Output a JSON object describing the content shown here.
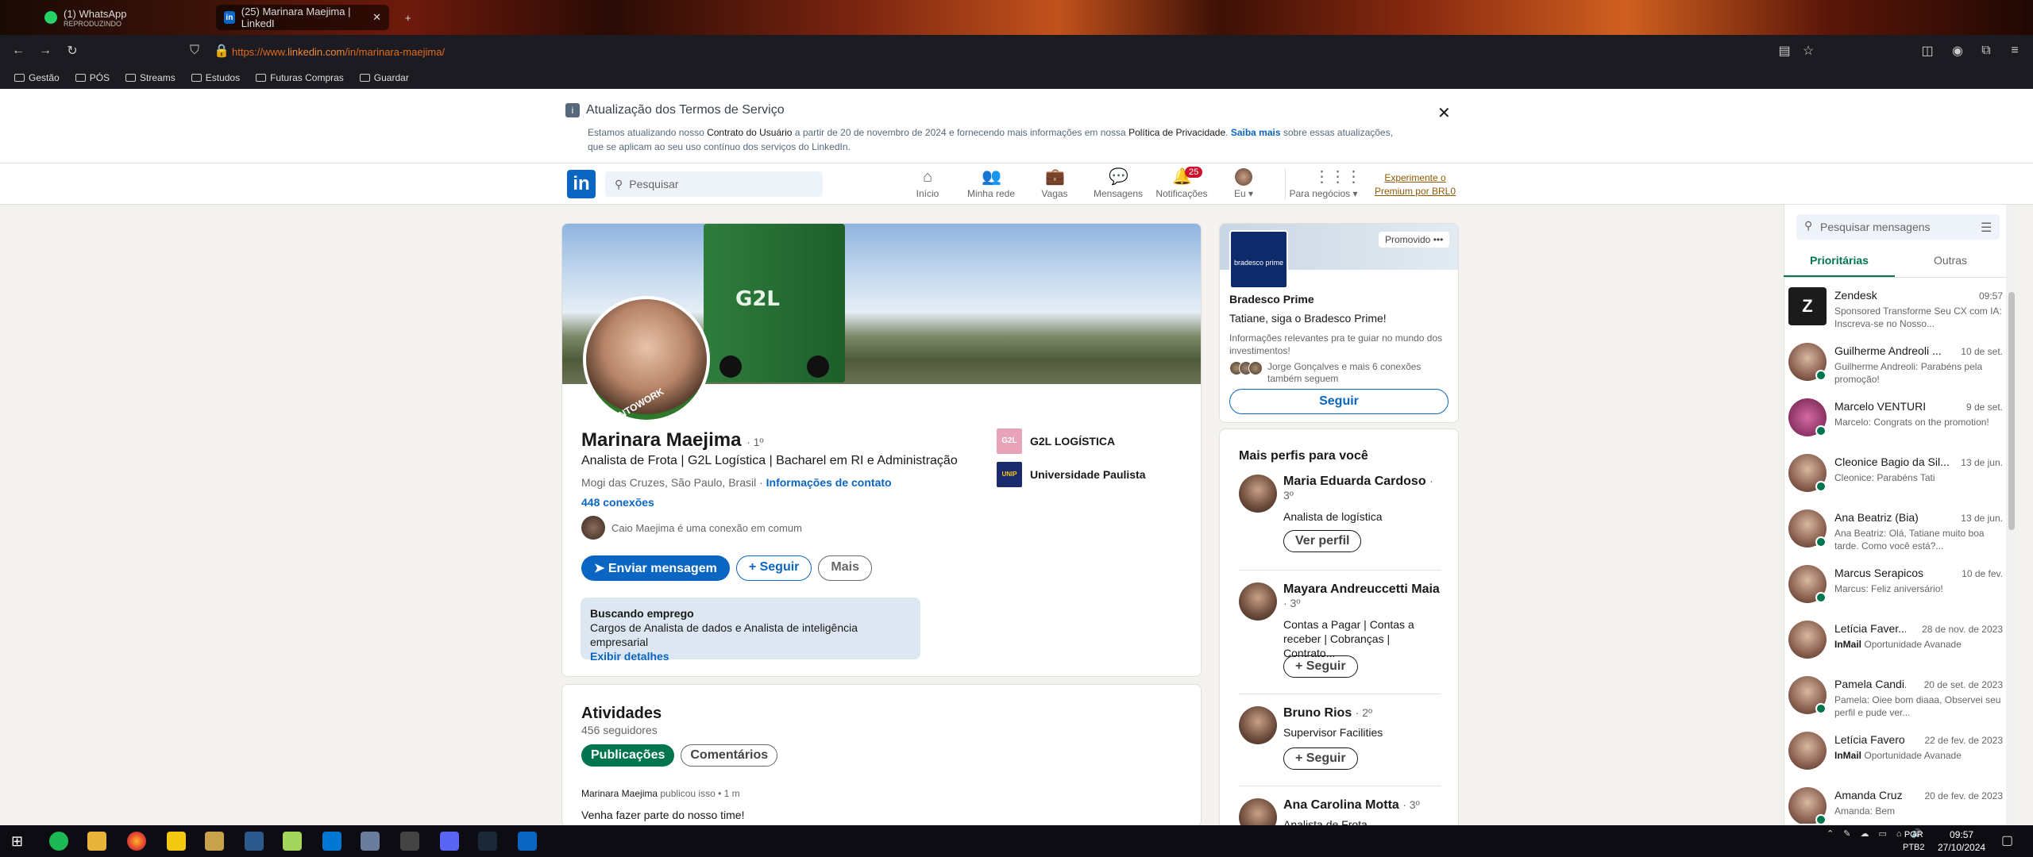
{
  "browser": {
    "tabs": [
      {
        "title": "(1) WhatsApp",
        "subtitle": "REPRODUZINDO"
      },
      {
        "title": "(25) Marinara Maejima | LinkedI"
      }
    ],
    "url_prefix": "https://www.",
    "url_host": "linkedin.com",
    "url_path": "/in/marinara-maejima/",
    "bookmarks": [
      "Gestão",
      "PÓS",
      "Streams",
      "Estudos",
      "Futuras Compras",
      "Guardar"
    ]
  },
  "banner": {
    "title": "Atualização dos Termos de Serviço",
    "text_1": "Estamos atualizando nosso ",
    "link_1": "Contrato do Usuário",
    "text_2": " a partir de 20 de novembro de 2024 e fornecendo mais informações em nossa ",
    "link_2": "Política de Privacidade",
    "text_3": ". ",
    "link_3": "Saiba mais",
    "text_4": " sobre essas atualizações, que se aplicam ao seu uso contínuo dos serviços do LinkedIn."
  },
  "header": {
    "logo": "in",
    "search_placeholder": "Pesquisar",
    "nav": [
      {
        "label": "Início",
        "icon": "home-icon"
      },
      {
        "label": "Minha rede",
        "icon": "network-icon"
      },
      {
        "label": "Vagas",
        "icon": "briefcase-icon"
      },
      {
        "label": "Mensagens",
        "icon": "chat-icon"
      },
      {
        "label": "Notificações",
        "icon": "bell-icon",
        "badge": "25"
      },
      {
        "label": "Eu",
        "icon": "avatar-icon"
      },
      {
        "label": "Para negócios",
        "icon": "grid-icon"
      }
    ],
    "premium": "Experimente o Premium por BRL0"
  },
  "profile": {
    "name": "Marinara Maejima",
    "degree": "· 1º",
    "headline": "Analista de Frota | G2L Logística | Bacharel em RI e Administração",
    "location": "Mogi das Cruzes, São Paulo, Brasil ·",
    "contact_link": "Informações de contato",
    "connections": "448 conexões",
    "mutual_name": "Caio Maejima",
    "mutual_text": "é uma conexão em comum",
    "cover_text": "G2L",
    "avatar_ring": "#OPENTOWORK",
    "actions": {
      "message": "Enviar mensagem",
      "follow": "+ Seguir",
      "more": "Mais"
    },
    "orgs": [
      {
        "name": "G2L LOGÍSTICA",
        "logo_text": "G2L",
        "color": "#e8a3b8"
      },
      {
        "name": "Universidade Paulista",
        "logo_text": "UNIP",
        "color": "#1a2a6c"
      }
    ],
    "open_to_work": {
      "title": "Buscando emprego",
      "roles": "Cargos de Analista de dados e Analista de inteligência empresarial",
      "link": "Exibir detalhes"
    }
  },
  "activity": {
    "title": "Atividades",
    "followers": "456 seguidores",
    "tabs": [
      "Publicações",
      "Comentários"
    ],
    "meta_name": "Marinara Maejima",
    "meta_rest": "publicou isso • 1 m",
    "post": "Venha fazer parte do nosso time!"
  },
  "ad": {
    "promo_label": "Promovido",
    "logo_text": "bradesco prime",
    "brand": "Bradesco Prime",
    "tagline": "Tatiane, siga o Bradesco Prime!",
    "description": "Informações relevantes pra te guiar no mundo dos investimentos!",
    "social": "Jorge Gonçalves e mais 6 conexões também seguem",
    "follow": "Seguir"
  },
  "more_profiles": {
    "title": "Mais perfis para você",
    "people": [
      {
        "name": "Maria Eduarda Cardoso",
        "degree": "· 3º",
        "desc": "Analista de logística",
        "button": "Ver perfil"
      },
      {
        "name": "Mayara Andreuccetti Maia",
        "degree": "· 3º",
        "desc": "Contas a Pagar | Contas a receber | Cobranças | Contrato...",
        "button": "+ Seguir"
      },
      {
        "name": "Bruno Rios",
        "degree": "· 2º",
        "desc": "Supervisor Facilities",
        "button": "+ Seguir"
      },
      {
        "name": "Ana Carolina Motta",
        "degree": "· 3º",
        "desc": "Analista de Frota",
        "button": ""
      }
    ]
  },
  "messaging": {
    "search_placeholder": "Pesquisar mensagens",
    "tabs": [
      "Prioritárias",
      "Outras"
    ],
    "conversations": [
      {
        "name": "Zendesk",
        "date": "09:57",
        "prefix": "Sponsored",
        "preview": "Transforme Seu CX com IA: Inscreva-se no Nosso..."
      },
      {
        "name": "Guilherme Andreoli ...",
        "date": "10 de set.",
        "prefix": "",
        "preview": "Guilherme Andreoli: Parabéns pela promoção!"
      },
      {
        "name": "Marcelo VENTURI",
        "date": "9 de set.",
        "prefix": "",
        "preview": "Marcelo: Congrats on the promotion!"
      },
      {
        "name": "Cleonice Bagio da Sil...",
        "date": "13 de jun.",
        "prefix": "",
        "preview": "Cleonice: Parabéns Tati"
      },
      {
        "name": "Ana Beatriz (Bia)",
        "date": "13 de jun.",
        "prefix": "",
        "preview": "Ana Beatriz: Olá, Tatiane muito boa tarde. Como você está?..."
      },
      {
        "name": "Marcus Serapicos",
        "date": "10 de fev.",
        "prefix": "",
        "preview": "Marcus: Feliz aniversário!"
      },
      {
        "name": "Letícia Faver...",
        "date": "28 de nov. de 2023",
        "prefix": "InMail",
        "preview": "Oportunidade Avanade"
      },
      {
        "name": "Pamela Candi...",
        "date": "20 de set. de 2023",
        "prefix": "",
        "preview": "Pamela: Oiee bom diaaa, Observei seu perfil e pude ver..."
      },
      {
        "name": "Letícia Favero...",
        "date": "22 de fev. de 2023",
        "prefix": "InMail",
        "preview": "Oportunidade Avanade"
      },
      {
        "name": "Amanda Cruz",
        "date": "20 de fev. de 2023",
        "prefix": "",
        "preview": "Amanda: Bem"
      }
    ]
  },
  "taskbar": {
    "lang_1": "POR",
    "lang_2": "PTB2",
    "time": "09:57",
    "date": "27/10/2024"
  }
}
